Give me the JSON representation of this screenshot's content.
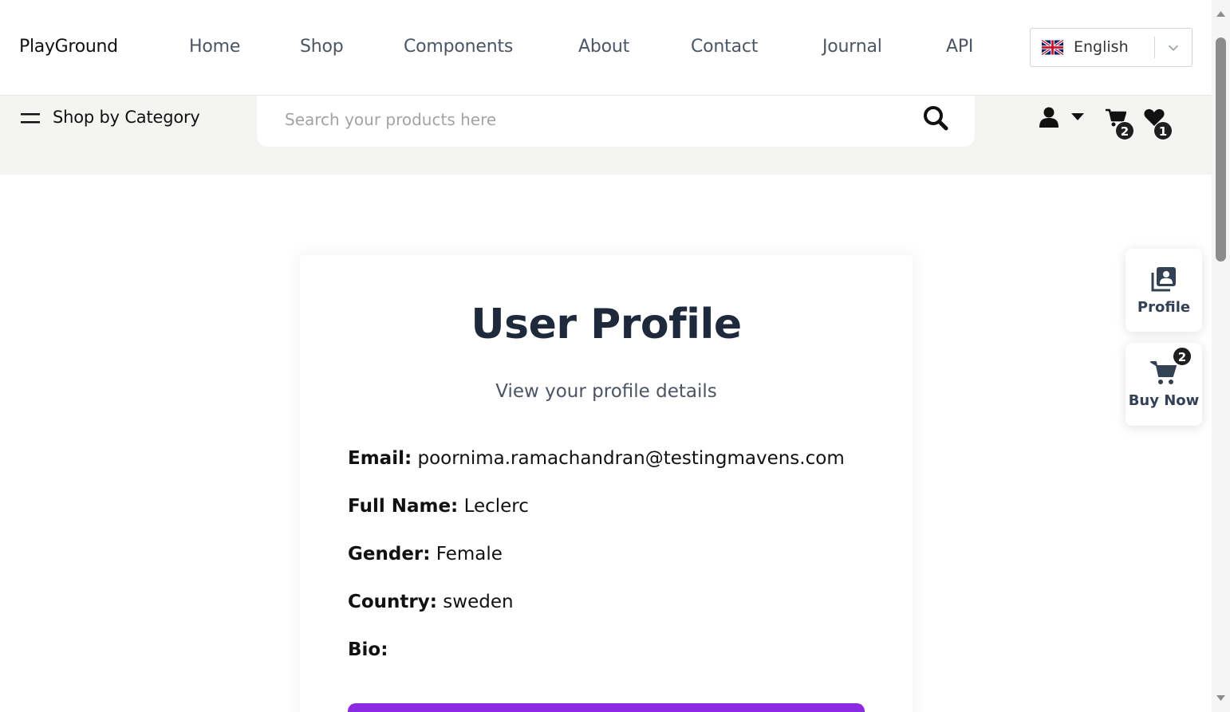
{
  "brand": "PlayGround",
  "nav": [
    "Home",
    "Shop",
    "Components",
    "About",
    "Contact",
    "Journal",
    "API"
  ],
  "language": {
    "label": "English",
    "flag_icon": "uk-flag-icon"
  },
  "category_label": "Shop by Category",
  "search": {
    "placeholder": "Search your products here",
    "value": ""
  },
  "header_icons": {
    "cart_count": "2",
    "wishlist_count": "1"
  },
  "profile": {
    "title": "User Profile",
    "subtitle": "View your profile details",
    "fields": [
      {
        "label": "Email:",
        "value": "poornima.ramachandran@testingmavens.com"
      },
      {
        "label": "Full Name:",
        "value": "Leclerc"
      },
      {
        "label": "Gender:",
        "value": "Female"
      },
      {
        "label": "Country:",
        "value": "sweden"
      },
      {
        "label": "Bio:",
        "value": ""
      }
    ]
  },
  "floating": {
    "profile_label": "Profile",
    "buy_label": "Buy Now",
    "buy_count": "2"
  },
  "colors": {
    "accent": "#8a2be2",
    "band": "#f4f4f2",
    "title": "#1e293b"
  }
}
